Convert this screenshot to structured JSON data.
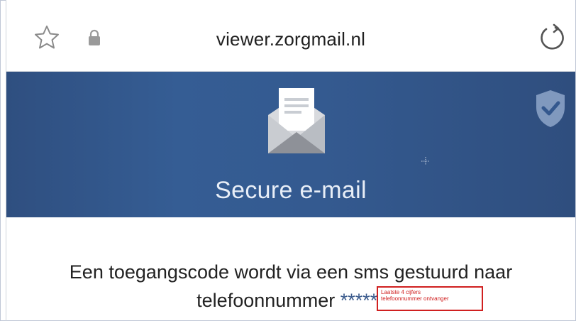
{
  "browser": {
    "url": "viewer.zorgmail.nl"
  },
  "hero": {
    "title": "Secure e-mail"
  },
  "message": {
    "line1": "Een toegangscode wordt via een sms gestuurd naar",
    "line2_prefix": "telefoonnummer",
    "phone_mask": "******"
  },
  "annotation": {
    "line1": "Laatste 4 cijfers",
    "line2": "telefoonnummer ontvanger"
  },
  "colors": {
    "hero_bg": "#345a90",
    "annotation": "#d02020"
  },
  "icons": [
    "star-icon",
    "lock-icon",
    "reload-icon",
    "envelope-icon",
    "shield-check-icon"
  ]
}
